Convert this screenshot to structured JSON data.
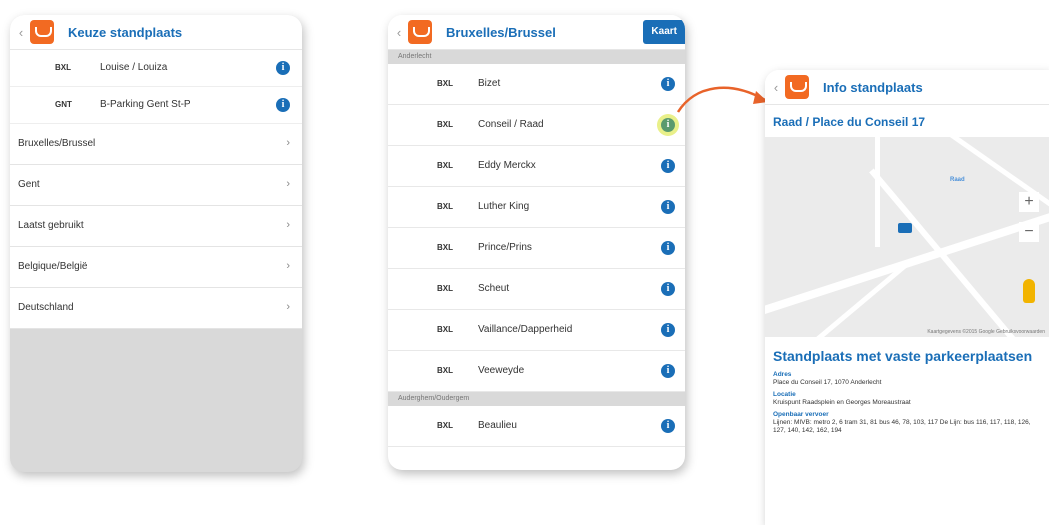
{
  "panel1": {
    "title": "Keuze standplaats",
    "favorites": [
      {
        "code": "BXL",
        "name": "Louise / Louiza"
      },
      {
        "code": "GNT",
        "name": "B-Parking Gent St-P"
      }
    ],
    "nav": [
      {
        "label": "Bruxelles/Brussel"
      },
      {
        "label": "Gent"
      },
      {
        "label": "Laatst gebruikt"
      },
      {
        "label": "Belgique/België"
      },
      {
        "label": "Deutschland"
      }
    ]
  },
  "panel2": {
    "title": "Bruxelles/Brussel",
    "kaart_label": "Kaart",
    "section1": "Anderlecht",
    "rows": [
      {
        "code": "BXL",
        "name": "Bizet"
      },
      {
        "code": "BXL",
        "name": "Conseil / Raad"
      },
      {
        "code": "BXL",
        "name": "Eddy Merckx"
      },
      {
        "code": "BXL",
        "name": "Luther King"
      },
      {
        "code": "BXL",
        "name": "Prince/Prins"
      },
      {
        "code": "BXL",
        "name": "Scheut"
      },
      {
        "code": "BXL",
        "name": "Vaillance/Dapperheid"
      },
      {
        "code": "BXL",
        "name": "Veeweyde"
      }
    ],
    "section2": "Auderghem/Oudergem",
    "rows2": [
      {
        "code": "BXL",
        "name": "Beaulieu"
      }
    ]
  },
  "panel3": {
    "title": "Info standplaats",
    "subtitle": "Raad / Place du Conseil 17",
    "map": {
      "zoom_in": "+",
      "zoom_out": "−",
      "label_raad": "Raad",
      "footer": "Kaartgegevens ©2015 Google   Gebruiksvoorwaarden"
    },
    "type_title": "Standplaats met vaste parkeerplaatsen",
    "adres_label": "Adres",
    "adres_value": "Place du Conseil 17, 1070 Anderlecht",
    "locatie_label": "Locatie",
    "locatie_value": "Kruispunt Raadsplein en Georges Moreaustraat",
    "ov_label": "Openbaar vervoer",
    "ov_value": "Lijnen: MIVB: metro 2, 6 tram 31, 81 bus 46, 78, 103, 117 De Lijn: bus 116, 117, 118, 126, 127, 140, 142, 162, 194"
  },
  "colors": {
    "brand_blue": "#1a6eb7",
    "brand_orange": "#f26a22",
    "arrow": "#e8632a"
  }
}
